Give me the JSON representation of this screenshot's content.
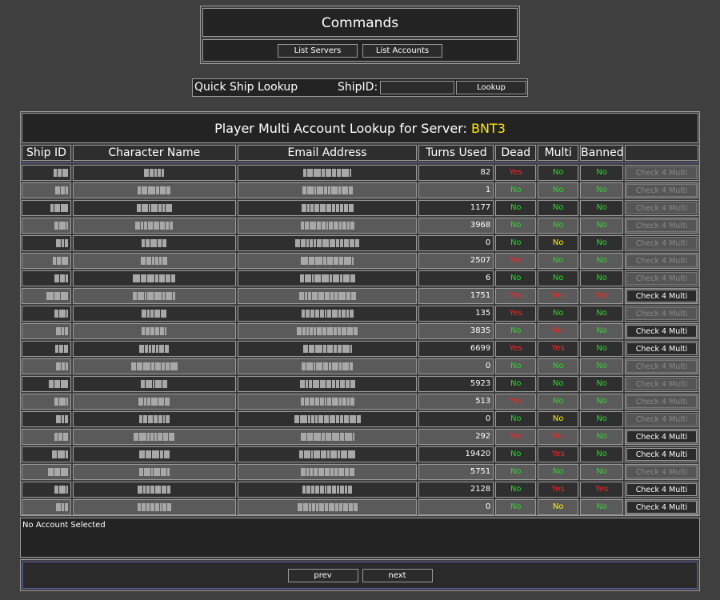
{
  "commands": {
    "title": "Commands",
    "list_servers": "List Servers",
    "list_accounts": "List Accounts"
  },
  "quick_lookup": {
    "title": "Quick Ship Lookup",
    "shipid_label": "ShipID:",
    "shipid_value": "",
    "lookup_button": "Lookup"
  },
  "lookup": {
    "title_prefix": "Player Multi Account Lookup for Server:",
    "server": "BNT3",
    "columns": [
      "Ship ID",
      "Character Name",
      "Email Address",
      "Turns Used",
      "Dead",
      "Multi",
      "Banned",
      ""
    ],
    "rows": [
      {
        "turns": "82",
        "dead": "Yes",
        "multi": "No",
        "banned": "No",
        "action": "Check 4 Multi",
        "enabled": false
      },
      {
        "turns": "1",
        "dead": "No",
        "multi": "No",
        "banned": "No",
        "action": "Check 4 Multi",
        "enabled": false
      },
      {
        "turns": "1177",
        "dead": "No",
        "multi": "No",
        "banned": "No",
        "action": "Check 4 Multi",
        "enabled": false
      },
      {
        "turns": "3968",
        "dead": "No",
        "multi": "No",
        "banned": "No",
        "action": "Check 4 Multi",
        "enabled": false
      },
      {
        "turns": "0",
        "dead": "No",
        "multi": "No",
        "banned": "No",
        "action": "Check 4 Multi",
        "enabled": false
      },
      {
        "turns": "2507",
        "dead": "Yes",
        "multi": "No",
        "banned": "No",
        "action": "Check 4 Multi",
        "enabled": false
      },
      {
        "turns": "6",
        "dead": "No",
        "multi": "No",
        "banned": "No",
        "action": "Check 4 Multi",
        "enabled": false
      },
      {
        "turns": "1751",
        "dead": "Yes",
        "multi": "Yes",
        "banned": "Yes",
        "action": "Check 4 Multi",
        "enabled": true
      },
      {
        "turns": "135",
        "dead": "Yes",
        "multi": "No",
        "banned": "No",
        "action": "Check 4 Multi",
        "enabled": false
      },
      {
        "turns": "3835",
        "dead": "No",
        "multi": "Yes",
        "banned": "No",
        "action": "Check 4 Multi",
        "enabled": true
      },
      {
        "turns": "6699",
        "dead": "Yes",
        "multi": "Yes",
        "banned": "No",
        "action": "Check 4 Multi",
        "enabled": true
      },
      {
        "turns": "0",
        "dead": "No",
        "multi": "No",
        "banned": "No",
        "action": "Check 4 Multi",
        "enabled": false
      },
      {
        "turns": "5923",
        "dead": "No",
        "multi": "No",
        "banned": "No",
        "action": "Check 4 Multi",
        "enabled": false
      },
      {
        "turns": "513",
        "dead": "Yes",
        "multi": "No",
        "banned": "No",
        "action": "Check 4 Multi",
        "enabled": false
      },
      {
        "turns": "0",
        "dead": "No",
        "multi": "No",
        "banned": "No",
        "action": "Check 4 Multi",
        "enabled": false
      },
      {
        "turns": "292",
        "dead": "Yes",
        "multi": "Yes",
        "banned": "No",
        "action": "Check 4 Multi",
        "enabled": true
      },
      {
        "turns": "19420",
        "dead": "No",
        "multi": "Yes",
        "banned": "No",
        "action": "Check 4 Multi",
        "enabled": true
      },
      {
        "turns": "5751",
        "dead": "No",
        "multi": "No",
        "banned": "No",
        "action": "Check 4 Multi",
        "enabled": false
      },
      {
        "turns": "2128",
        "dead": "No",
        "multi": "Yes",
        "banned": "Yes",
        "action": "Check 4 Multi",
        "enabled": true
      },
      {
        "turns": "0",
        "dead": "No",
        "multi": "No",
        "banned": "No",
        "action": "Check 4 Multi",
        "enabled": true
      }
    ],
    "yellow_multi_rows": [
      4,
      14,
      19
    ]
  },
  "status": {
    "text": "No Account Selected"
  },
  "pager": {
    "prev": "prev",
    "next": "next"
  },
  "colors": {
    "background": "#3f3f3f",
    "panel": "#232323",
    "server_name": "#ffea00",
    "yes": "#ff2222",
    "no": "#22dd22"
  }
}
